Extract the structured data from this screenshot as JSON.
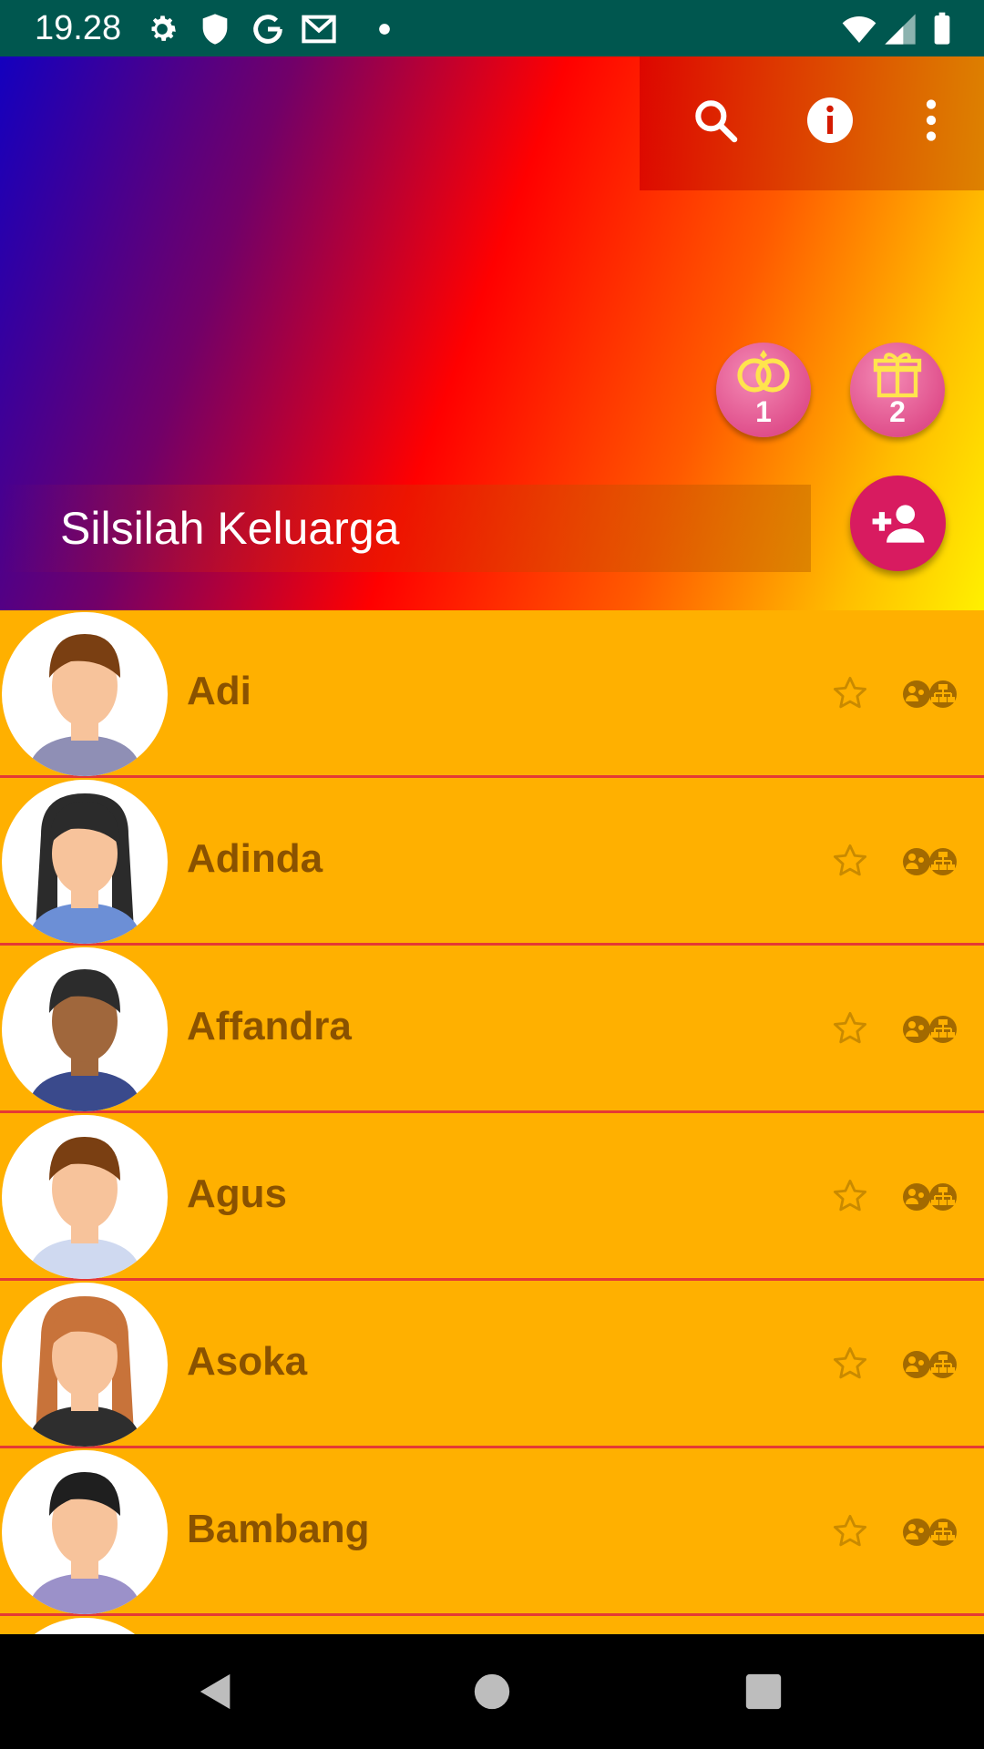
{
  "status_bar": {
    "time": "19.28",
    "icons": [
      "settings-icon",
      "shield-icon",
      "google-icon",
      "gmail-icon",
      "dot-icon",
      "wifi-icon",
      "signal-icon",
      "battery-icon"
    ]
  },
  "toolbar": {
    "actions": [
      "search-icon",
      "info-icon",
      "more-vert-icon"
    ]
  },
  "badges": {
    "wedding": {
      "icon": "rings-icon",
      "count": "1"
    },
    "birthday": {
      "icon": "gift-icon",
      "count": "2"
    }
  },
  "header": {
    "title": "Silsilah Keluarga"
  },
  "fab": {
    "icon": "add-person-icon"
  },
  "colors": {
    "status_bar": "#00574f",
    "list_background": "#ffb000",
    "name_text": "#8a5200",
    "divider": "#e53935",
    "fab": "#d81b60"
  },
  "members": [
    {
      "name": "Adi"
    },
    {
      "name": "Adinda"
    },
    {
      "name": "Affandra"
    },
    {
      "name": "Agus"
    },
    {
      "name": "Asoka"
    },
    {
      "name": "Bambang"
    }
  ],
  "nav_bar": {
    "buttons": [
      "back-icon",
      "home-icon",
      "recents-icon"
    ]
  }
}
